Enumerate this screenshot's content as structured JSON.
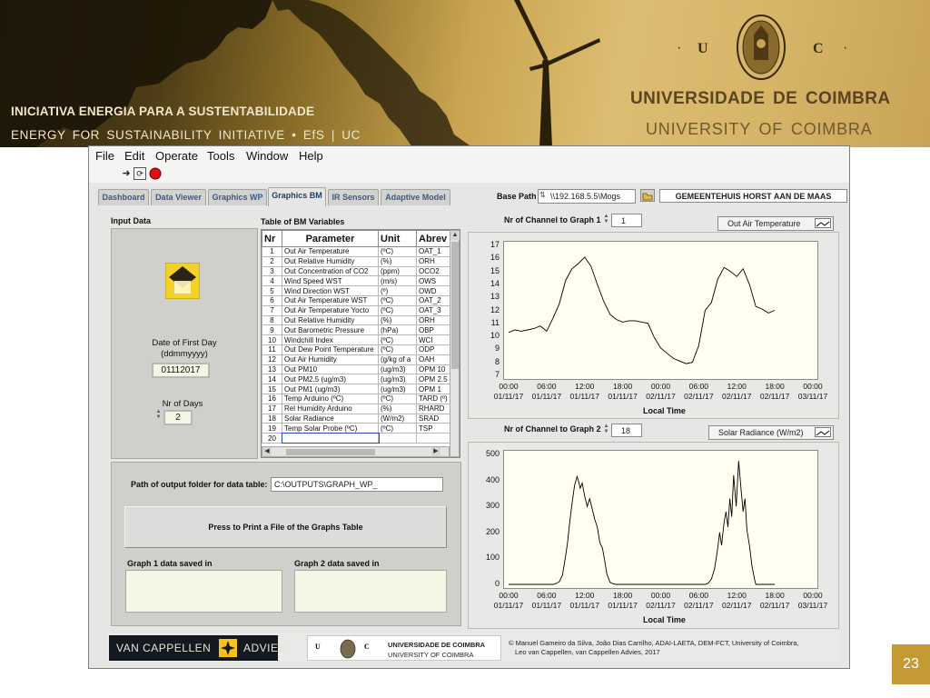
{
  "slide": {
    "initiative_pt": "INICIATIVA ENERGIA  PARA  A  SUSTENTABILIDADE",
    "initiative_en": "ENERGY  FOR  SUSTAINABILITY  INITIATIVE  •    EfS | UC",
    "uc_u": "U",
    "uc_c": "C",
    "uc_dot": "·",
    "university_pt": "UNIVERSIDADE  DE  COIMBRA",
    "university_en": "UNIVERSITY  OF  COIMBRA",
    "page_number": "23"
  },
  "app": {
    "menu": [
      "File",
      "Edit",
      "Operate",
      "Tools",
      "Window",
      "Help"
    ],
    "tabs": [
      "Dashboard",
      "Data Viewer",
      "Graphics WP",
      "Graphics BM",
      "IR Sensors",
      "Adaptive Model"
    ],
    "active_tab": "Graphics BM",
    "base_path_label": "Base Path",
    "base_path_value": "\\\\192.168.5.5\\Mogs",
    "site_name": "GEMEENTEHUIS HORST AAN DE MAAS",
    "input_data_label": "Input Data",
    "date_first_day_label": "Date of First Day\n(ddmmyyyy)",
    "date_first_day_value": "01112017",
    "nr_of_days_label": "Nr of Days",
    "nr_of_days_value": "2",
    "table_title": "Table of BM Variables",
    "table_headers": [
      "Nr",
      "Parameter",
      "Unit",
      "Abrev"
    ],
    "table_rows": [
      [
        "1",
        "Out Air Temperature",
        "(ºC)",
        "OAT_1"
      ],
      [
        "2",
        "Out Relative Humidity",
        "(%)",
        "ORH"
      ],
      [
        "3",
        "Out Concentration of CO2",
        "(ppm)",
        "OCO2"
      ],
      [
        "4",
        "Wind Speed WST",
        "(m/s)",
        "OWS"
      ],
      [
        "5",
        "Wind Direction WST",
        "(º)",
        "OWD"
      ],
      [
        "6",
        "Out Air Temperature WST",
        "(ºC)",
        "OAT_2"
      ],
      [
        "7",
        "Out  Air Temperature Yocto",
        "(ºC)",
        "OAT_3"
      ],
      [
        "8",
        "Out Relative Humidity",
        "(%)",
        "ORH"
      ],
      [
        "9",
        "Out Barometric Pressure",
        "(hPa)",
        "OBP"
      ],
      [
        "10",
        "Windchill Index",
        "(ºC)",
        "WCI"
      ],
      [
        "11",
        "Out Dew Point Temperature",
        "(ºC)",
        "ODP"
      ],
      [
        "12",
        "Out Air Humidity",
        "(g/kg of a",
        "OAH"
      ],
      [
        "13",
        "Out PM10",
        "(ug/m3)",
        "OPM 10"
      ],
      [
        "14",
        "Out PM2.5  (ug/m3)",
        "(ug/m3)",
        "OPM 2.5"
      ],
      [
        "15",
        "Out PM1 (ug/m3)",
        "(ug/m3)",
        "OPM 1"
      ],
      [
        "16",
        "Temp Arduino (ºC)",
        "(ºC)",
        "TARD (º)"
      ],
      [
        "17",
        "Rel Humidity Arduino",
        "(%)",
        "RHARD"
      ],
      [
        "18",
        "Solar Radiance",
        " (W/m2)",
        "SRAD"
      ],
      [
        "19",
        "Temp Solar Probe (ºC)",
        "(ºC)",
        "TSP"
      ],
      [
        "20",
        "",
        "",
        ""
      ]
    ],
    "output_path_label": "Path of output folder for data table:",
    "output_path_value": "C:\\OUTPUTS\\GRAPH_WP_",
    "print_button_label": "Press to Print a File of the Graphs Table",
    "graph1_saved_label": "Graph 1 data saved in",
    "graph2_saved_label": "Graph 2 data saved in",
    "graph1_channel_label": "Nr of Channel to Graph 1",
    "graph1_channel_value": "1",
    "graph1_legend": "Out Air Temperature",
    "graph2_channel_label": "Nr of Channel to Graph 2",
    "graph2_channel_value": "18",
    "graph2_legend": "Solar Radiance  (W/m2)",
    "logo_vancappellen_left": "VAN CAPPELLEN",
    "logo_vancappellen_right": "ADVIES",
    "logo_uc_u": "U",
    "logo_uc_c": "C",
    "logo_uc_line1": "UNIVERSIDADE  DE  COIMBRA",
    "logo_uc_line2": "UNIVERSITY  OF  COIMBRA",
    "copyright_line1": "© Manuel Gameiro da Silva, João Dias Carrilho, ADAI-LAETA, DEM-FCT, University  of Coimbra,",
    "copyright_line2": "Leo van Cappellen, van Cappellen Advies, 2017"
  },
  "chart_data": [
    {
      "type": "line",
      "series": [
        {
          "name": "Out Air Temperature",
          "x_hours": [
            0,
            1,
            2,
            3,
            4,
            5,
            6,
            7,
            8,
            9,
            10,
            11,
            12,
            13,
            14,
            15,
            16,
            17,
            18,
            19,
            20,
            21,
            22,
            23,
            24,
            25,
            26,
            27,
            28,
            29,
            30,
            31,
            32,
            33,
            34,
            35,
            36,
            37,
            38,
            39,
            40,
            41,
            42
          ],
          "values": [
            10.3,
            10.5,
            10.4,
            10.5,
            10.6,
            10.8,
            10.4,
            11.4,
            12.5,
            14.3,
            15.2,
            15.6,
            16.1,
            15.4,
            14.0,
            12.7,
            11.7,
            11.3,
            11.1,
            11.2,
            11.2,
            11.1,
            11.0,
            9.9,
            9.1,
            8.7,
            8.3,
            8.1,
            7.9,
            8.0,
            9.3,
            12.0,
            12.6,
            14.4,
            15.3,
            15.0,
            14.6,
            15.2,
            14.0,
            12.3,
            12.1,
            11.8,
            12.0
          ]
        }
      ],
      "x_tick_labels": [
        "00:00 01/11/17",
        "06:00 01/11/17",
        "12:00 01/11/17",
        "18:00 01/11/17",
        "00:00 02/11/17",
        "06:00 02/11/17",
        "12:00 02/11/17",
        "18:00 02/11/17",
        "00:00 03/11/17"
      ],
      "y_ticks": [
        7,
        8,
        9,
        10,
        11,
        12,
        13,
        14,
        15,
        16,
        17
      ],
      "ylim": [
        7,
        17
      ],
      "xlabel": "Local Time",
      "ylabel": ""
    },
    {
      "type": "line",
      "series": [
        {
          "name": "Solar Radiance  (W/m2)",
          "x_hours": [
            0,
            6,
            7,
            7.5,
            8,
            8.5,
            9,
            9.3,
            9.6,
            10,
            10.4,
            10.8,
            11,
            11.3,
            11.6,
            12,
            12.4,
            12.8,
            13.2,
            13.6,
            14,
            14.4,
            14.8,
            15.1,
            15.5,
            16,
            16.5,
            17,
            24,
            30,
            31,
            31.5,
            32,
            32.5,
            33,
            33.3,
            33.6,
            34,
            34.3,
            34.6,
            34.9,
            35.2,
            35.5,
            35.9,
            36.3,
            36.7,
            37,
            37.3,
            37.6,
            38,
            38.4,
            38.8,
            39,
            42
          ],
          "values": [
            0,
            0,
            0,
            3,
            10,
            35,
            110,
            160,
            230,
            310,
            380,
            415,
            400,
            370,
            390,
            340,
            300,
            330,
            290,
            250,
            220,
            160,
            140,
            100,
            40,
            8,
            2,
            0,
            0,
            0,
            0,
            5,
            20,
            60,
            140,
            200,
            150,
            240,
            280,
            220,
            330,
            260,
            420,
            300,
            475,
            360,
            280,
            330,
            210,
            150,
            70,
            20,
            0,
            0
          ]
        }
      ],
      "x_tick_labels": [
        "00:00 01/11/17",
        "06:00 01/11/17",
        "12:00 01/11/17",
        "18:00 01/11/17",
        "00:00 02/11/17",
        "06:00 02/11/17",
        "12:00 02/11/17",
        "18:00 02/11/17",
        "00:00 03/11/17"
      ],
      "y_ticks": [
        0,
        100,
        200,
        300,
        400,
        500
      ],
      "ylim": [
        0,
        500
      ],
      "xlabel": "Local Time",
      "ylabel": ""
    }
  ],
  "colors": {
    "header_light_text": "#f1e6c7",
    "university_text": "#5a4520",
    "page_number_bg": "#c49a35",
    "tab_text": "#3d5a7f",
    "plot_background": "#fffef0",
    "input_background": "#f1f7e4",
    "trace_color": "#000000"
  },
  "icons": [
    "run-arrow-icon",
    "run-continuous-icon",
    "abort-stop-icon",
    "folder-browse-icon",
    "warning-logo-icon",
    "uc-seal-icon",
    "wind-turbine-silhouette",
    "plot-line-legend-icon"
  ]
}
